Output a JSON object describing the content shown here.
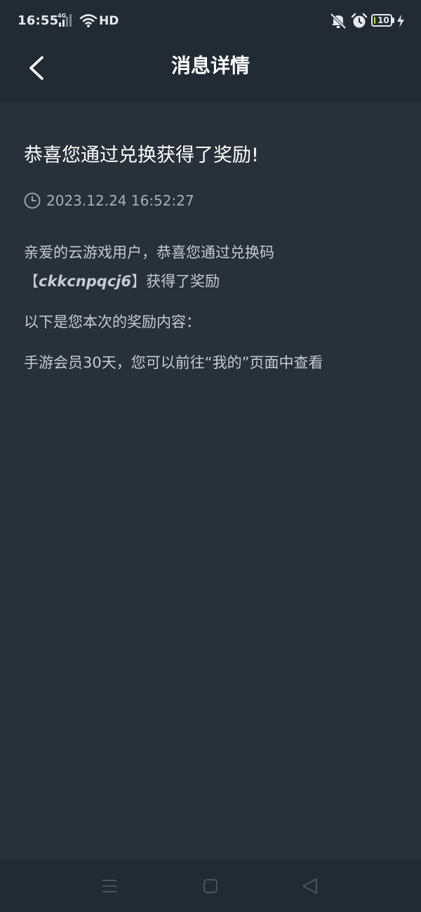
{
  "status_bar": {
    "time": "16:55",
    "network": "4G",
    "wifi_label": "HD",
    "battery_level": "10",
    "battery_fraction": 0.1,
    "icons": [
      "signal-icon",
      "wifi-icon",
      "bell-off-icon",
      "alarm-icon",
      "battery-icon",
      "charging-icon"
    ]
  },
  "header": {
    "title": "消息详情",
    "back_icon": "chevron-left-icon"
  },
  "message": {
    "title": "恭喜您通过兑换获得了奖励!",
    "time": "2023.12.24 16:52:27",
    "body_line1_prefix": "亲爱的云游戏用户，恭喜您通过兑换码",
    "code_open": "【",
    "code": "ckkcnpqcj6",
    "code_close": "】",
    "body_line1_suffix": "获得了奖励",
    "body_line2": "以下是您本次的奖励内容：",
    "body_line3": "手游会员30天，您可以前往“我的”页面中查看"
  },
  "system_nav": {
    "icons": [
      "menu-icon",
      "home-icon",
      "back-triangle-icon"
    ]
  },
  "colors": {
    "background": "#283039",
    "header": "#222a33",
    "title_text": "#ffffff",
    "body_text": "#c6cbd2",
    "muted_text": "#a7adb5",
    "battery_fill": "#d7dd35"
  }
}
